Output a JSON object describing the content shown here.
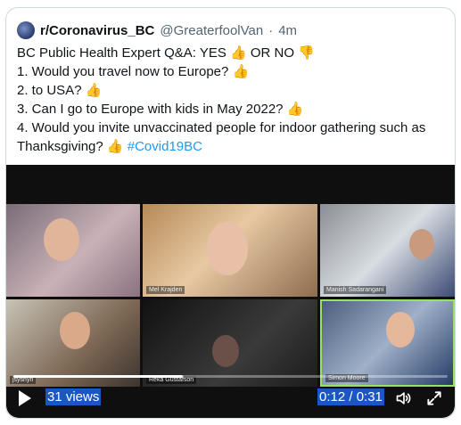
{
  "tweet": {
    "account": "r/Coronavirus_BC",
    "handle": "@GreaterfoolVan",
    "time": "4m",
    "lines": [
      {
        "text": "BC Public Health Expert Q&A: YES ",
        "thumb1": "👍",
        "mid": " OR NO ",
        "thumb2": "👎"
      },
      {
        "text": "1. Would you travel now to Europe? ",
        "thumb1": "👍"
      },
      {
        "text": "2. to USA? ",
        "thumb1": "👍"
      },
      {
        "text": "3. Can I go to Europe with kids in May 2022? ",
        "thumb1": "👍"
      },
      {
        "text": "4. Would you invite unvaccinated people for indoor gathering such as"
      },
      {
        "text": "Thanksgiving? ",
        "thumb1": "👍",
        "hashtag": " #Covid19BC"
      }
    ]
  },
  "video": {
    "participants": [
      "",
      "Mel Krajden",
      "Manish Sadarangani",
      "jsyshyn",
      "Reka Gustafson",
      "Simon Moore"
    ],
    "progress": 0.39,
    "views": "31 views",
    "time": "0:12 / 0:31",
    "icons": {
      "play": "play-icon",
      "volume": "volume-icon",
      "fullscreen": "fullscreen-icon"
    }
  }
}
